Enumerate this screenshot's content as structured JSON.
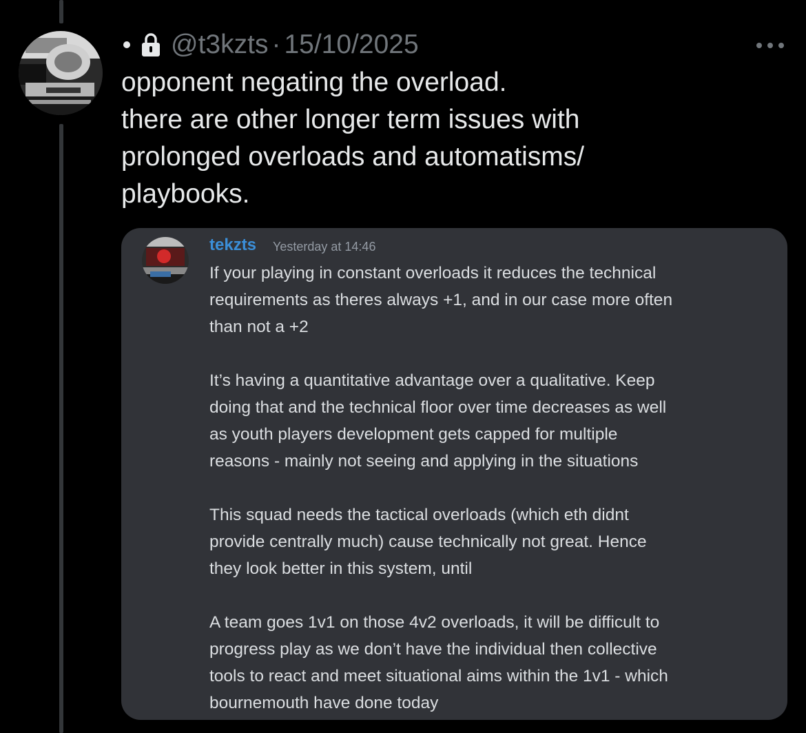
{
  "tweet": {
    "separator_dot": "•",
    "handle": "@t3kzts",
    "separator": "·",
    "date": "15/10/2025",
    "lines": [
      "opponent negating the overload.",
      "there are other longer term issues with",
      "prolonged overloads and automatisms/",
      "playbooks."
    ]
  },
  "icons": {
    "lock": "lock-icon",
    "more": "more-options-icon",
    "avatar": "profile-avatar"
  },
  "embed": {
    "username": "tekzts",
    "timestamp": "Yesterday at 14:46",
    "paragraphs": [
      [
        "If your playing in constant overloads it reduces the technical",
        "requirements as theres always +1, and in our case more often",
        "than not a +2"
      ],
      [
        "It’s having a quantitative advantage over a qualitative. Keep",
        "doing that and the technical floor over time decreases as well",
        "as youth players development gets capped for multiple",
        "reasons - mainly not seeing and applying in the situations"
      ],
      [
        "This squad needs the tactical overloads (which eth didnt",
        "provide centrally much) cause technically not great. Hence",
        "they look better in this system, until"
      ],
      [
        "A team goes 1v1 on those 4v2 overloads, it will be difficult to",
        "progress play as we don’t have the individual then collective",
        "tools to react and meet situational aims within the 1v1 - which",
        "bournemouth have done today"
      ]
    ]
  },
  "colors": {
    "background": "#000000",
    "text_primary": "#e7e9ea",
    "text_secondary": "#71767b",
    "thread_line": "#333639",
    "embed_background": "#313338",
    "embed_username": "#3b8fd9",
    "embed_text": "#dbdee1"
  }
}
